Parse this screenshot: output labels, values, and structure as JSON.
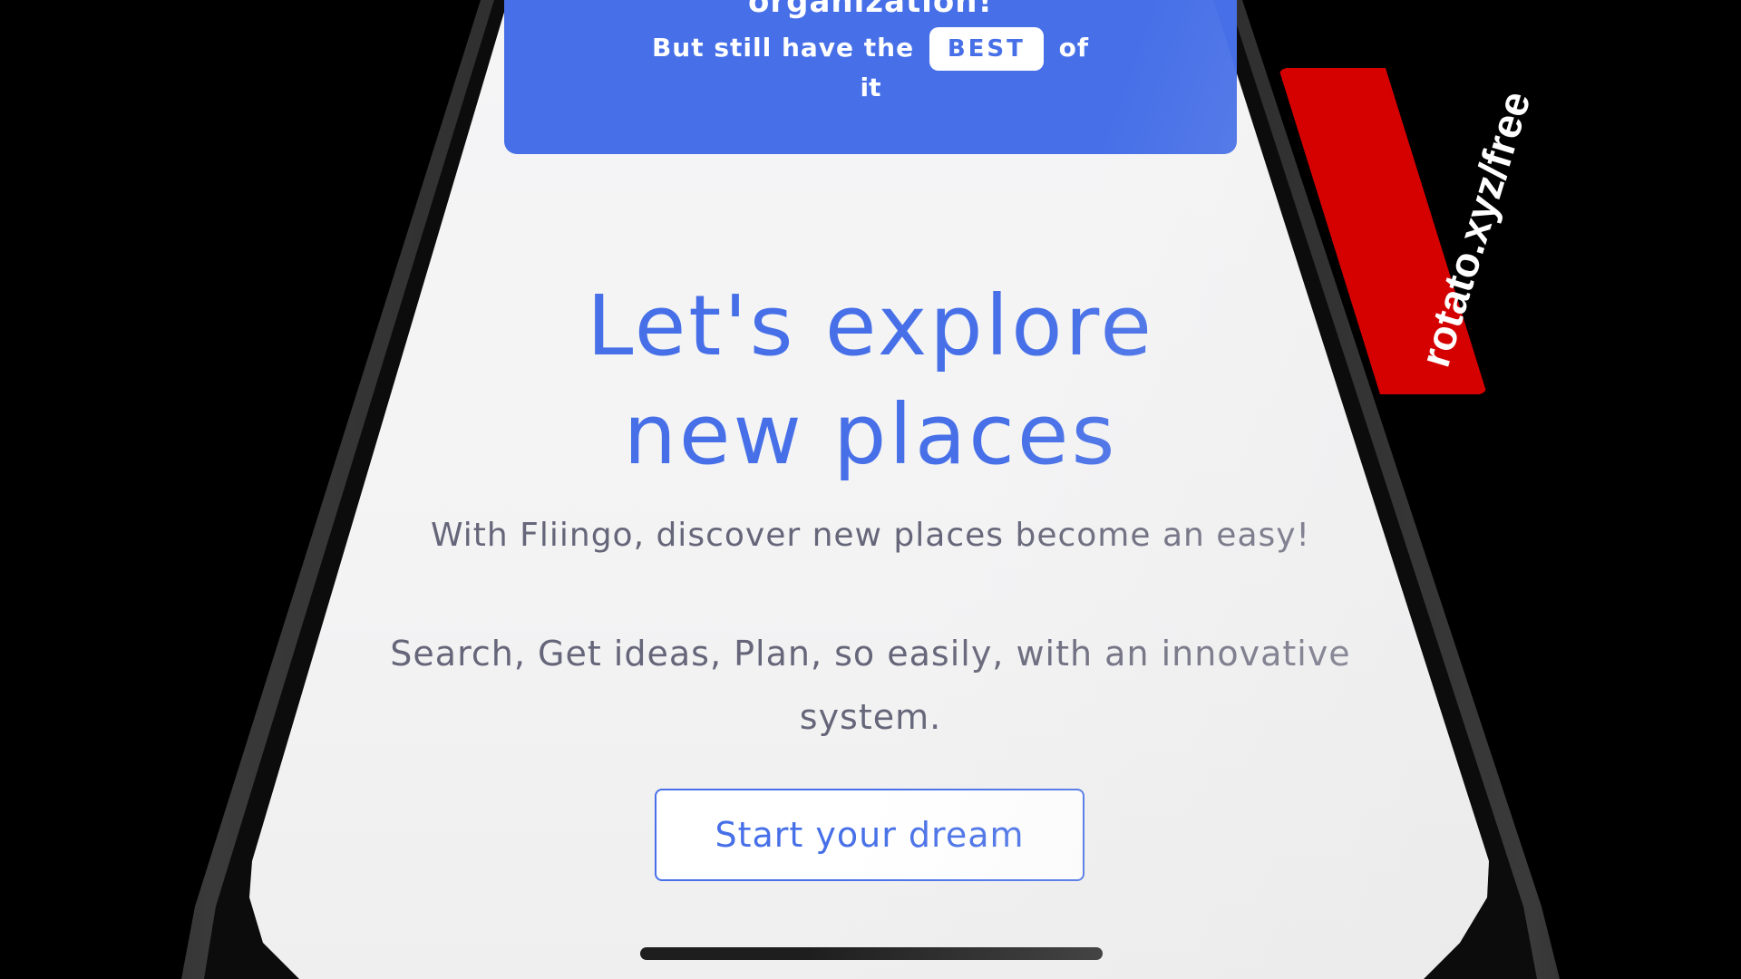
{
  "banner": {
    "title": "organization!",
    "line_prefix": "But still have the",
    "badge": "BEST",
    "line_suffix": "of",
    "line2": "it"
  },
  "hero": {
    "title_line1": "Let's explore",
    "title_line2": "new places",
    "subtitle": "With Fliingo, discover new places become an easy!",
    "tagline": "Search, Get ideas, Plan, so easily, with an innovative system."
  },
  "cta": {
    "label": "Start your dream"
  },
  "watermark": {
    "text": "rotato.xyz/free"
  },
  "colors": {
    "accent": "#4770e8",
    "watermark": "#d50000",
    "text_muted": "#66667a"
  }
}
